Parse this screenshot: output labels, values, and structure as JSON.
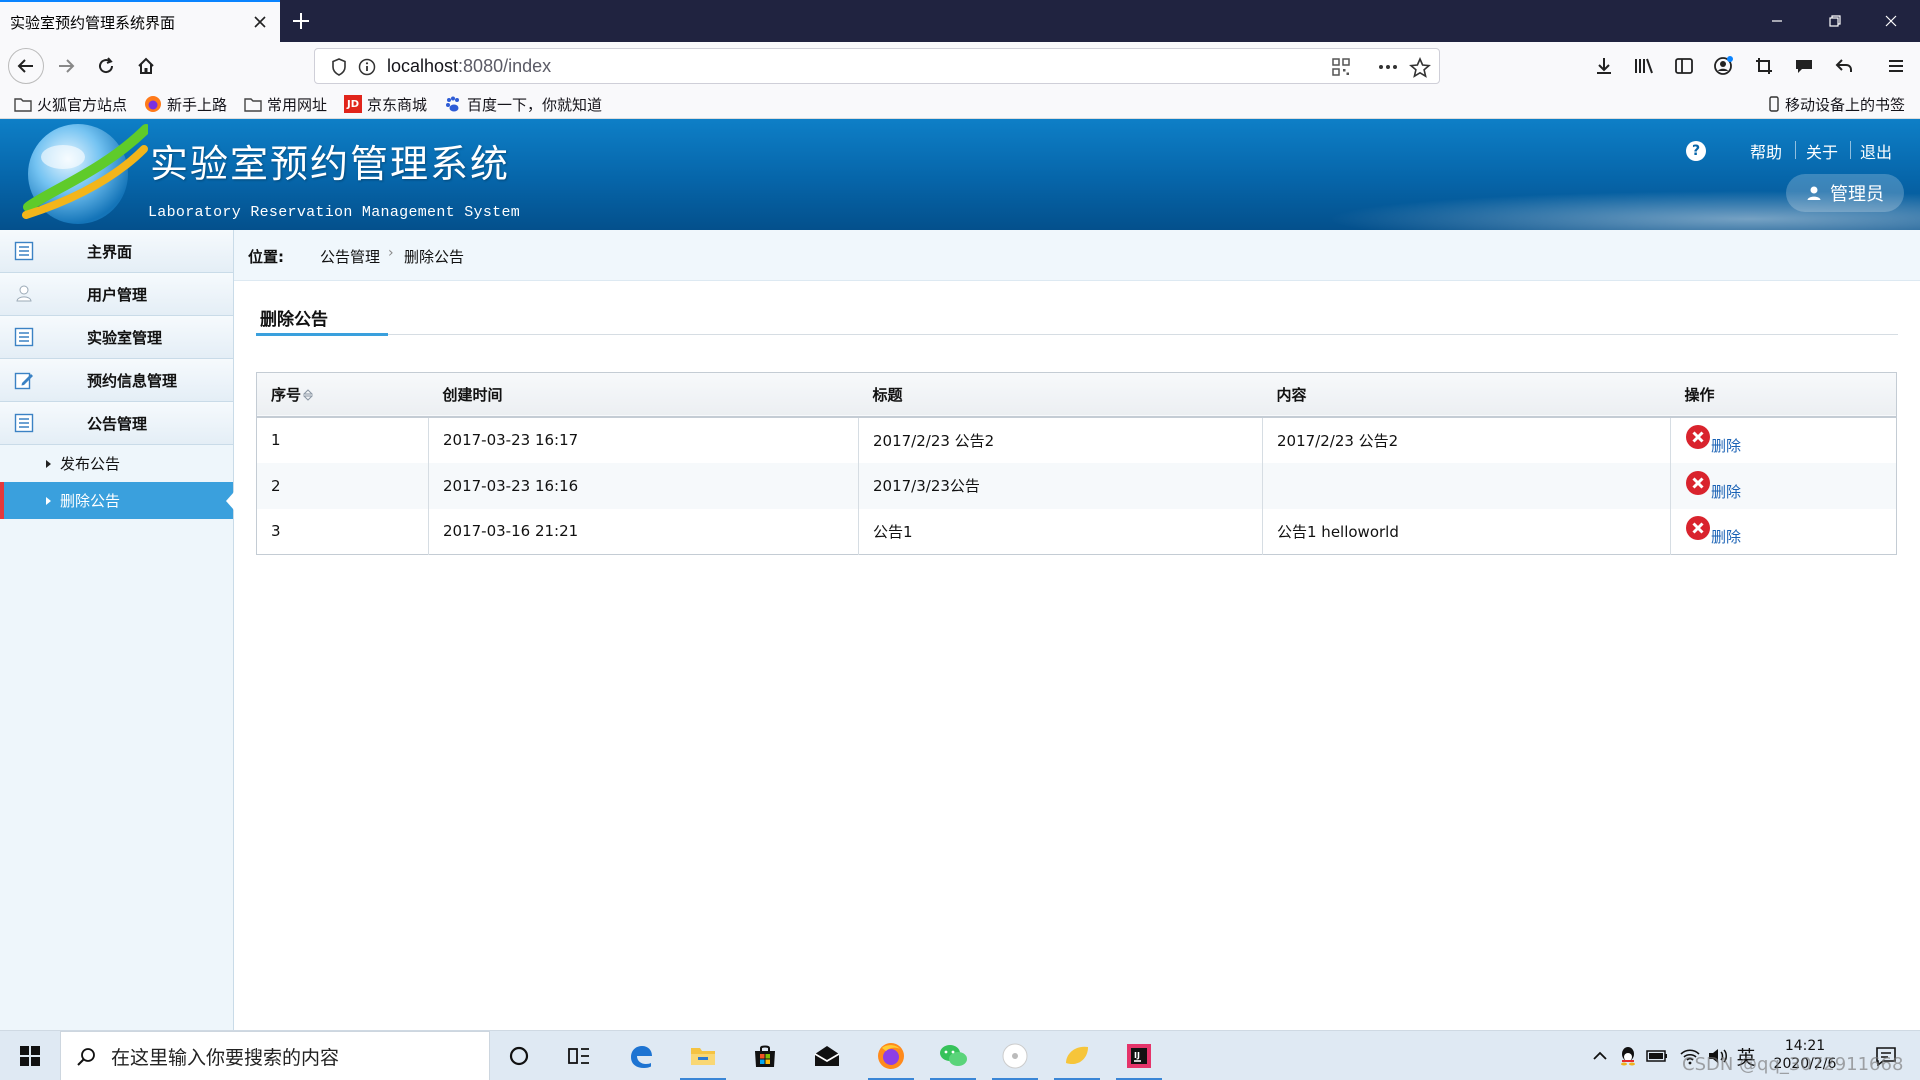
{
  "browser": {
    "tab_title": "实验室预约管理系统界面",
    "url_host": "localhost",
    "url_path": ":8080/index",
    "bookmarks": [
      "火狐官方站点",
      "新手上路",
      "常用网址",
      "京东商城",
      "百度一下，你就知道"
    ],
    "mobile_bookmarks": "移动设备上的书签"
  },
  "header": {
    "title": "实验室预约管理系统",
    "subtitle": "Laboratory Reservation Management System",
    "links": {
      "help": "帮助",
      "about": "关于",
      "logout": "退出"
    },
    "user": "管理员"
  },
  "sidebar": {
    "items": [
      {
        "label": "主界面",
        "icon": "list-icon"
      },
      {
        "label": "用户管理",
        "icon": "user-icon"
      },
      {
        "label": "实验室管理",
        "icon": "list-icon"
      },
      {
        "label": "预约信息管理",
        "icon": "edit-icon"
      },
      {
        "label": "公告管理",
        "icon": "list-icon"
      }
    ],
    "subitems": [
      {
        "label": "发布公告",
        "active": false
      },
      {
        "label": "删除公告",
        "active": true
      }
    ]
  },
  "breadcrumb": {
    "label": "位置:",
    "level1": "公告管理",
    "level2": "删除公告"
  },
  "section_title": "删除公告",
  "table": {
    "columns": [
      "序号",
      "创建时间",
      "标题",
      "内容",
      "操作"
    ],
    "rows": [
      {
        "id": "1",
        "created": "2017-03-23 16:17",
        "title": "2017/2/23 公告2",
        "content": "2017/2/23 公告2",
        "action": "删除"
      },
      {
        "id": "2",
        "created": "2017-03-23 16:16",
        "title": "2017/3/23公告",
        "content": "",
        "action": "删除"
      },
      {
        "id": "3",
        "created": "2017-03-16 21:21",
        "title": "公告1",
        "content": "公告1 helloworld",
        "action": "删除"
      }
    ]
  },
  "taskbar": {
    "search_placeholder": "在这里输入你要搜索的内容",
    "ime": "英",
    "time": "14:21",
    "date": "2020/2/6"
  },
  "watermark": "CSDN @qq_3072911668",
  "colors": {
    "accent": "#3aa0dd",
    "header": "#0665a9",
    "link": "#1a62b5",
    "delete": "#d9232d"
  }
}
